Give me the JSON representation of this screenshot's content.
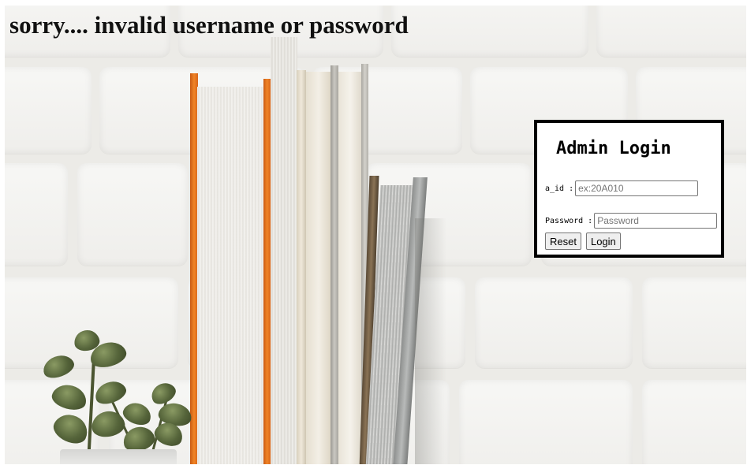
{
  "error": {
    "message": "sorry.... invalid username or password"
  },
  "login": {
    "title": "Admin Login",
    "id_label": "a_id :",
    "id_placeholder": "ex:20A010",
    "id_value": "",
    "password_label": "Password :",
    "password_placeholder": "Password",
    "password_value": "",
    "reset_label": "Reset",
    "login_label": "Login"
  },
  "colors": {
    "wall": "#f3f3f1",
    "book_orange": "#e8731c",
    "plant_green": "#55643a",
    "box_border": "#000000"
  }
}
